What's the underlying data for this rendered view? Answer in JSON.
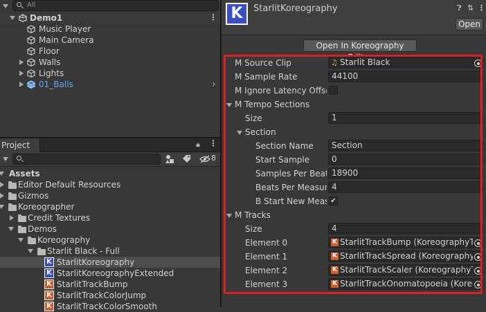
{
  "hierarchy": {
    "search_placeholder": "All",
    "scene": "Demo1",
    "items": [
      "Music Player",
      "Main Camera",
      "Floor",
      "Walls",
      "Lights",
      "01_Balls"
    ]
  },
  "project": {
    "tab_label": "Project",
    "count": "8",
    "tree": [
      {
        "label": "Assets",
        "bold": true
      },
      {
        "label": "Editor Default Resources"
      },
      {
        "label": "Gizmos"
      },
      {
        "label": "Koreographer"
      },
      {
        "label": "Credit Textures"
      },
      {
        "label": "Demos"
      },
      {
        "label": "Koreography"
      },
      {
        "label": "Starlit Black - Full"
      },
      {
        "label": "StarlitKoreography"
      },
      {
        "label": "StarlitKoreographyExtended"
      },
      {
        "label": "StarlitTrackBump"
      },
      {
        "label": "StarlitTrackColorJump"
      },
      {
        "label": "StarlitTrackColorSmooth"
      }
    ]
  },
  "inspector": {
    "title": "StarlitKoreography",
    "open_label": "Open",
    "open_editor_label": "Open In Koreography Editor",
    "source_clip": {
      "label": "M Source Clip",
      "value": "Starlit Black"
    },
    "sample_rate": {
      "label": "M Sample Rate",
      "value": "44100"
    },
    "ignore_latency": {
      "label": "M Ignore Latency Offset",
      "checked": false
    },
    "tempo_sections": {
      "label": "M Tempo Sections",
      "size_label": "Size",
      "size": "1",
      "section_label": "Section",
      "fields": [
        {
          "label": "Section Name",
          "value": "Section"
        },
        {
          "label": "Start Sample",
          "value": "0"
        },
        {
          "label": "Samples Per Beat",
          "value": "18900"
        },
        {
          "label": "Beats Per Measure",
          "value": "4"
        }
      ],
      "start_new_measure": {
        "label": "B Start New Measure",
        "checked": true
      }
    },
    "tracks": {
      "label": "M Tracks",
      "size_label": "Size",
      "size": "4",
      "elements": [
        {
          "label": "Element 0",
          "value": "StarlitTrackBump (KoreographyTrack)"
        },
        {
          "label": "Element 1",
          "value": "StarlitTrackSpread (KoreographyTrack)"
        },
        {
          "label": "Element 2",
          "value": "StarlitTrackScaler (KoreographyTrack)"
        },
        {
          "label": "Element 3",
          "value": "StarlitTrackOnomatopoeia (KoreographyTrack)"
        }
      ]
    }
  },
  "colors": {
    "highlight": "#e02020",
    "koreography_icon": "#3b4fc4",
    "track_icon": "#d15e2a",
    "prefab_blue": "#59a9ea"
  }
}
